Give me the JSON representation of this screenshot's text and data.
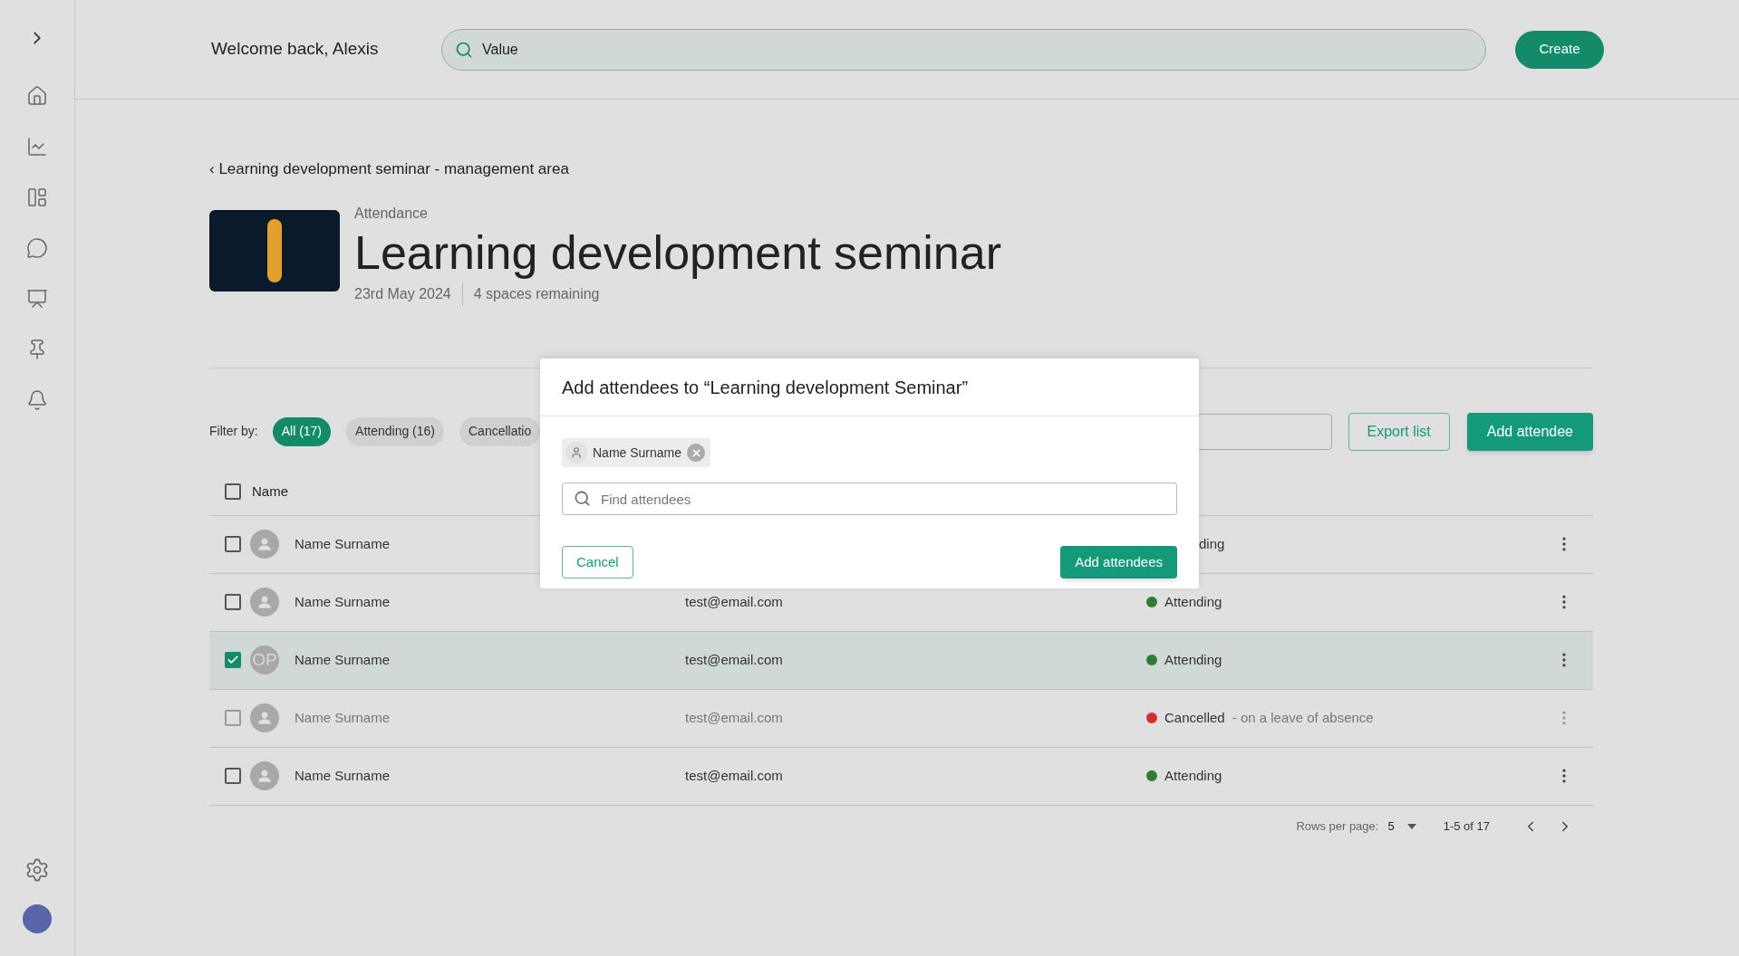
{
  "header": {
    "greeting": "Welcome back, Alexis",
    "search": {
      "value": "Value"
    },
    "create_button": "Create"
  },
  "breadcrumb": "‹ Learning development seminar - management area",
  "event": {
    "label": "Attendance",
    "title": "Learning development seminar",
    "date": "23rd May 2024",
    "spaces": "4 spaces remaining"
  },
  "filters": {
    "label": "Filter by:",
    "chips": [
      {
        "label": "All (17)",
        "selected": true
      },
      {
        "label": "Attending (16)",
        "selected": false
      },
      {
        "label": "Cancellatio",
        "selected": false
      }
    ]
  },
  "actions": [
    {
      "label": "Export list",
      "kind": "outline"
    },
    {
      "label": "Add attendee",
      "kind": "filled"
    }
  ],
  "table": {
    "columns": [
      "Name"
    ],
    "all_checked": false,
    "rows": [
      {
        "name": "Name Surname",
        "status": "ding",
        "checked": false,
        "disabled": false,
        "avatar": {
          "kind": "icon"
        }
      },
      {
        "name": "Name Surname",
        "email": "test@email.com",
        "status": "Attending",
        "color": "#2e7d32",
        "checked": false,
        "disabled": false,
        "avatar": {
          "kind": "icon"
        }
      },
      {
        "name": "Name Surname",
        "email": "test@email.com",
        "status": "Attending",
        "color": "#2e7d32",
        "checked": true,
        "disabled": false,
        "avatar": {
          "kind": "initials",
          "text": "OP"
        }
      },
      {
        "name": "Name Surname",
        "email": "test@email.com",
        "status": "Cancelled",
        "status_note": "- on a leave of absence",
        "color": "#d32f2f",
        "checked": false,
        "disabled": true,
        "avatar": {
          "kind": "icon"
        }
      },
      {
        "name": "Name Surname",
        "email": "test@email.com",
        "status": "Attending",
        "color": "#2e7d32",
        "checked": false,
        "disabled": false,
        "avatar": {
          "kind": "icon"
        }
      }
    ],
    "pagination": {
      "rows_label": "Rows per page:",
      "rows_value": "5",
      "range": "1-5 of 17"
    }
  },
  "dialog": {
    "title": "Add attendees to “Learning development Seminar”",
    "chips": [
      {
        "label": "Name Surname"
      }
    ],
    "search": {
      "placeholder": "Find attendees"
    },
    "buttons": [
      {
        "label": "Cancel",
        "kind": "outline"
      },
      {
        "label": "Add attendees",
        "kind": "filled"
      }
    ]
  }
}
